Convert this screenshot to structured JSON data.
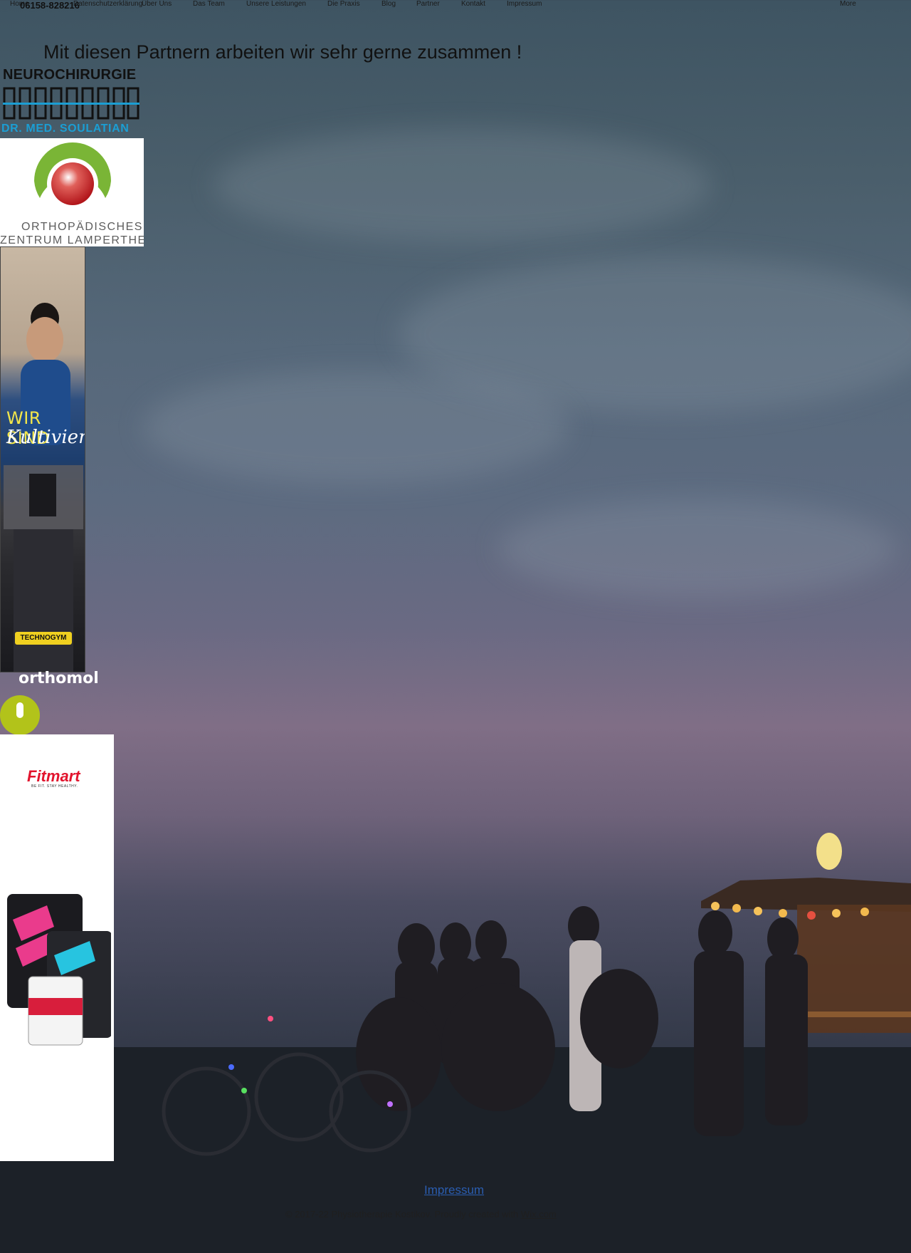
{
  "header": {
    "phone": "06158-828216",
    "nav": [
      "Home",
      "Datenschutzerklärung",
      "Über Uns",
      "Das Team",
      "Unsere Leistungen",
      "Die Praxis",
      "Blog",
      "Partner",
      "Kontakt",
      "Impressum",
      "More"
    ]
  },
  "main": {
    "headline": "Mit diesen Partnern arbeiten wir sehr gerne zusammen !"
  },
  "partners": {
    "neuro": {
      "title": "NEUROCHIRURGIE",
      "doctor": "DR. MED. SOULATIAN"
    },
    "ortho": {
      "line1": "ORTHOPÄDISCHES",
      "line2": "ZENTRUM LAMPERTHEIM"
    },
    "technogym": {
      "line1": "WIR SIND",
      "line2": "Kultiviert",
      "badge": "TECHNOGYM"
    },
    "orthomol": {
      "name": "orthomol"
    },
    "fitmart": {
      "name": "Fitmart",
      "slogan": "BE FIT. STAY HEALTHY."
    }
  },
  "footer": {
    "impressum": "Impressum",
    "copyright": "© 2017-22 Physiotherapie Kostikov. Proudly created with",
    "wix": "Wix.com"
  },
  "colors": {
    "accent_blue": "#1b9ed3",
    "ortho_green": "#7ab536",
    "ortho_red": "#c8201e",
    "orthomol_green": "#b2c31a",
    "fitmart_red": "#e2142d",
    "link_blue": "#2a5db0"
  }
}
